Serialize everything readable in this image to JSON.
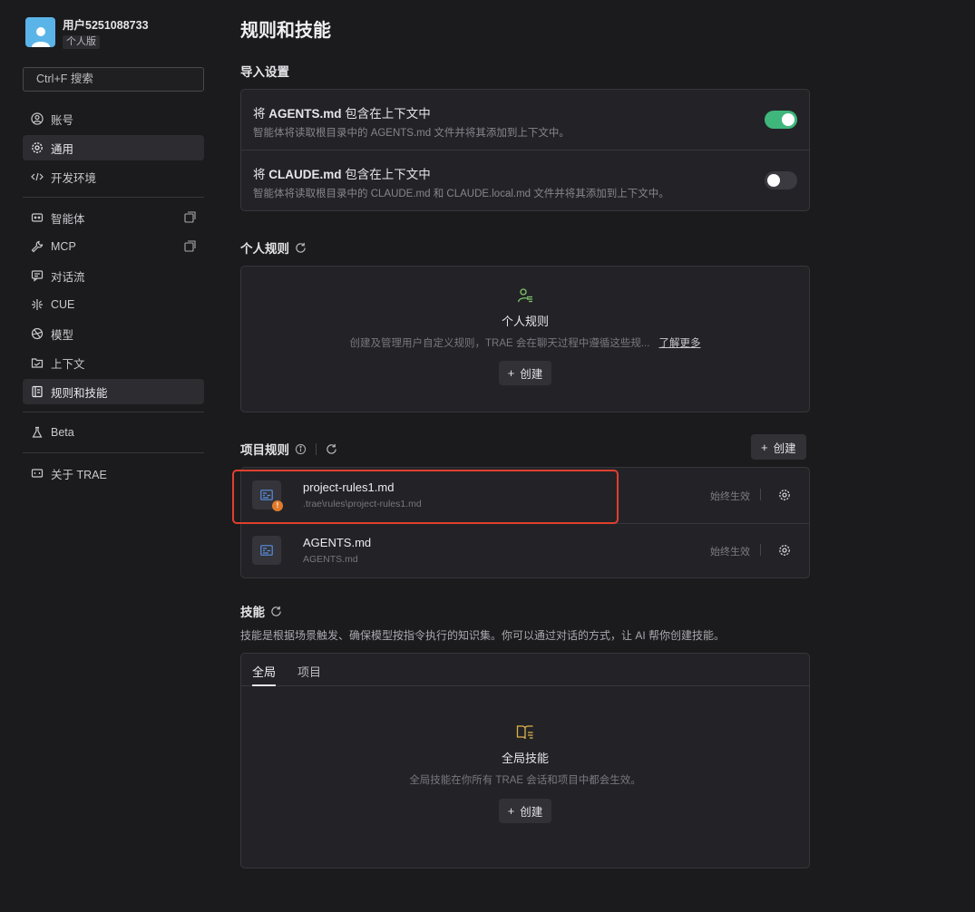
{
  "user": {
    "name": "用户5251088733",
    "badge": "个人版"
  },
  "search": {
    "label": "Ctrl+F 搜索"
  },
  "sidebar": {
    "items": [
      {
        "label": "账号",
        "icon": "user-circle-icon"
      },
      {
        "label": "通用",
        "icon": "gear-icon",
        "active": true
      },
      {
        "label": "开发环境",
        "icon": "code-icon"
      },
      {
        "label": "智能体",
        "icon": "robot-icon",
        "external": true
      },
      {
        "label": "MCP",
        "icon": "wrench-icon",
        "external": true
      },
      {
        "label": "对话流",
        "icon": "chat-flow-icon"
      },
      {
        "label": "CUE",
        "icon": "cue-icon"
      },
      {
        "label": "模型",
        "icon": "model-icon"
      },
      {
        "label": "上下文",
        "icon": "context-icon"
      },
      {
        "label": "规则和技能",
        "icon": "rules-icon"
      },
      {
        "label": "Beta",
        "icon": "flask-icon"
      },
      {
        "label": "关于 TRAE",
        "icon": "trae-icon"
      }
    ]
  },
  "main": {
    "title": "规则和技能",
    "import": {
      "title": "导入设置",
      "rows": [
        {
          "prefix": "将 ",
          "name": "AGENTS.md",
          "suffix": " 包含在上下文中",
          "desc": "智能体将读取根目录中的 AGENTS.md 文件并将其添加到上下文中。",
          "enabled": true
        },
        {
          "prefix": "将 ",
          "name": "CLAUDE.md",
          "suffix": " 包含在上下文中",
          "desc": "智能体将读取根目录中的 CLAUDE.md 和 CLAUDE.local.md 文件并将其添加到上下文中。",
          "enabled": false
        }
      ]
    },
    "personal": {
      "title": "个人规则",
      "empty_title": "个人规则",
      "empty_desc": "创建及管理用户自定义规则，TRAE 会在聊天过程中遵循这些规...",
      "learn_more": "了解更多",
      "create": "创建"
    },
    "project": {
      "title": "项目规则",
      "create": "创建",
      "rules": [
        {
          "name": "project-rules1.md",
          "path": ".trae\\rules\\project-rules1.md",
          "status": "始终生效",
          "warning": "!"
        },
        {
          "name": "AGENTS.md",
          "path": "AGENTS.md",
          "status": "始终生效"
        }
      ]
    },
    "skills": {
      "title": "技能",
      "desc": "技能是根据场景触发、确保模型按指令执行的知识集。你可以通过对话的方式，让 AI 帮你创建技能。",
      "tabs": [
        "全局",
        "项目"
      ],
      "empty_title": "全局技能",
      "empty_desc": "全局技能在你所有 TRAE 会话和项目中都会生效。",
      "create": "创建"
    }
  },
  "colors": {
    "accent_green": "#3fb67c",
    "highlight_red": "#e0402e",
    "warning_orange": "#e27a2b"
  }
}
